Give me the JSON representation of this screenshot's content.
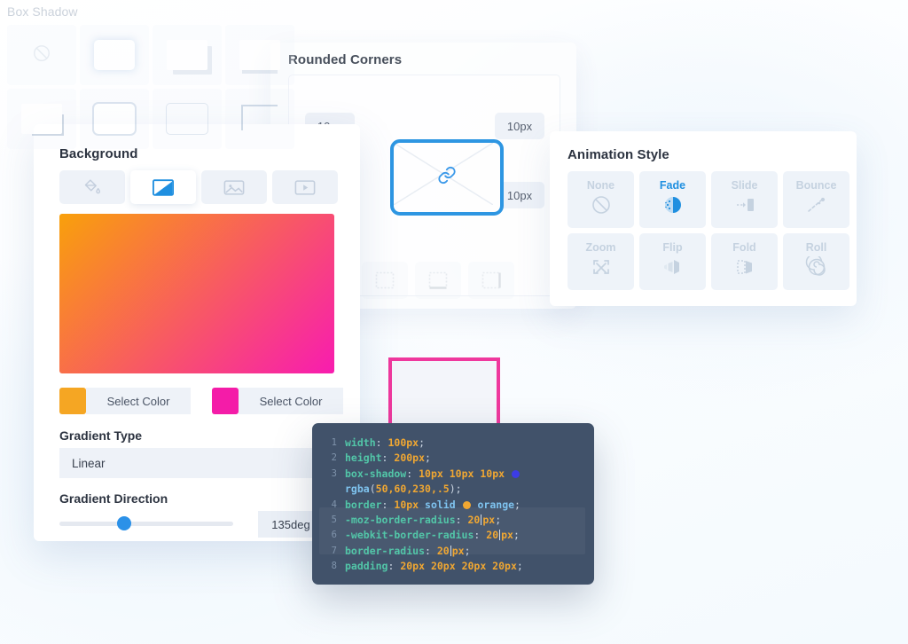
{
  "rounded_corners": {
    "title": "Rounded Corners",
    "link_icon": "link-icon",
    "corners": [
      {
        "name": "top-left",
        "value": "10px"
      },
      {
        "name": "top-right",
        "value": "10px"
      },
      {
        "name": "bottom-right",
        "value": "10px"
      }
    ],
    "border_side_icons": [
      "border-left-icon",
      "border-top-icon",
      "border-bottom-icon",
      "border-right-icon"
    ],
    "preview_border_color": "#1f8fe0",
    "pink_preview_border_color": "#ef2a96"
  },
  "background": {
    "title": "Background",
    "tabs": [
      {
        "label": "",
        "icon": "paint-bucket-icon",
        "active": false
      },
      {
        "label": "",
        "icon": "gradient-icon",
        "active": true
      },
      {
        "label": "",
        "icon": "image-icon",
        "active": false
      },
      {
        "label": "",
        "icon": "video-icon",
        "active": false
      }
    ],
    "gradient_preview": {
      "start_color": "#f9a00b",
      "end_color": "#f81cb0",
      "angle": "135deg"
    },
    "colors": [
      {
        "swatch": "#f5a623",
        "button_label": "Select Color",
        "name": "gradient-start"
      },
      {
        "swatch": "#f41ca8",
        "button_label": "Select Color",
        "name": "gradient-end"
      }
    ],
    "gradient_type": {
      "label": "Gradient Type",
      "value": "Linear"
    },
    "gradient_direction": {
      "label": "Gradient Direction",
      "value": "135deg",
      "slider_percent": 37
    }
  },
  "animation": {
    "title": "Animation Style",
    "options": [
      {
        "label": "None",
        "icon": "no-entry-icon",
        "active": false
      },
      {
        "label": "Fade",
        "icon": "fade-icon",
        "active": true
      },
      {
        "label": "Slide",
        "icon": "slide-icon",
        "active": false
      },
      {
        "label": "Bounce",
        "icon": "bounce-icon",
        "active": false
      },
      {
        "label": "Zoom",
        "icon": "zoom-icon",
        "active": false
      },
      {
        "label": "Flip",
        "icon": "flip-icon",
        "active": false
      },
      {
        "label": "Fold",
        "icon": "fold-icon",
        "active": false
      },
      {
        "label": "Roll",
        "icon": "roll-icon",
        "active": false
      }
    ],
    "active_color": "#1f8fe0"
  },
  "box_shadow": {
    "title": "Box Shadow",
    "presets": [
      {
        "name": "none",
        "icon": "no-shadow-icon"
      },
      {
        "name": "glow",
        "icon": "shadow-glow-icon"
      },
      {
        "name": "bottom-right",
        "icon": "shadow-bottom-right-icon"
      },
      {
        "name": "bottom-line",
        "icon": "shadow-bottom-line-icon"
      },
      {
        "name": "offset-corner",
        "icon": "shadow-offset-corner-icon"
      },
      {
        "name": "all-around",
        "icon": "shadow-all-around-icon"
      },
      {
        "name": "outline",
        "icon": "shadow-outline-icon"
      },
      {
        "name": "top-left",
        "icon": "shadow-top-left-icon"
      }
    ]
  },
  "code": {
    "language": "css",
    "lines": [
      {
        "no": "1",
        "tokens": [
          {
            "t": "prop",
            "v": "width"
          },
          {
            "t": "pun",
            "v": ": "
          },
          {
            "t": "val",
            "v": "100px"
          },
          {
            "t": "pun",
            "v": ";"
          }
        ]
      },
      {
        "no": "2",
        "tokens": [
          {
            "t": "prop",
            "v": "height"
          },
          {
            "t": "pun",
            "v": ": "
          },
          {
            "t": "val",
            "v": "200px"
          },
          {
            "t": "pun",
            "v": ";"
          }
        ]
      },
      {
        "no": "3",
        "tokens": [
          {
            "t": "prop",
            "v": "box-shadow"
          },
          {
            "t": "pun",
            "v": ": "
          },
          {
            "t": "val",
            "v": "10px 10px 10px "
          },
          {
            "t": "swatch",
            "v": "#3c3ce6"
          }
        ]
      },
      {
        "no": "",
        "tokens": [
          {
            "t": "fn",
            "v": "rgba"
          },
          {
            "t": "pun",
            "v": "("
          },
          {
            "t": "val",
            "v": "50,60,230,.5"
          },
          {
            "t": "pun",
            "v": ");"
          }
        ]
      },
      {
        "no": "4",
        "tokens": [
          {
            "t": "prop",
            "v": "border"
          },
          {
            "t": "pun",
            "v": ": "
          },
          {
            "t": "val",
            "v": "10px "
          },
          {
            "t": "kw",
            "v": "solid "
          },
          {
            "t": "swatch",
            "v": "#f0a732"
          },
          {
            "t": "kw",
            "v": " orange"
          },
          {
            "t": "pun",
            "v": ";"
          }
        ]
      },
      {
        "no": "5",
        "tokens": [
          {
            "t": "prop",
            "v": "-moz-border-radius"
          },
          {
            "t": "pun",
            "v": ": "
          },
          {
            "t": "val",
            "v": "20"
          },
          {
            "t": "caret",
            "v": ""
          },
          {
            "t": "val",
            "v": "px"
          },
          {
            "t": "pun",
            "v": ";"
          }
        ]
      },
      {
        "no": "6",
        "tokens": [
          {
            "t": "prop",
            "v": "-webkit-border-radius"
          },
          {
            "t": "pun",
            "v": ": "
          },
          {
            "t": "val",
            "v": "20"
          },
          {
            "t": "caret",
            "v": ""
          },
          {
            "t": "val",
            "v": "px"
          },
          {
            "t": "pun",
            "v": ";"
          }
        ]
      },
      {
        "no": "7",
        "tokens": [
          {
            "t": "prop",
            "v": "border-radius"
          },
          {
            "t": "pun",
            "v": ": "
          },
          {
            "t": "val",
            "v": "20"
          },
          {
            "t": "caret",
            "v": ""
          },
          {
            "t": "val",
            "v": "px"
          },
          {
            "t": "pun",
            "v": ";"
          }
        ]
      },
      {
        "no": "8",
        "tokens": [
          {
            "t": "prop",
            "v": "padding"
          },
          {
            "t": "pun",
            "v": ": "
          },
          {
            "t": "val",
            "v": "20px 20px 20px 20px"
          },
          {
            "t": "pun",
            "v": ";"
          }
        ]
      }
    ]
  }
}
